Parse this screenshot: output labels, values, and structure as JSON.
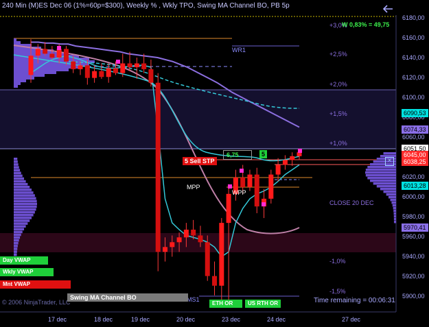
{
  "window": {
    "title": "240 Min (M)ES Dec 06  (1%=60p=$300), Weekly % , Wkly TPO, Swing MA Channel BO, PB 5p",
    "back_icon": "arrow-left-icon"
  },
  "colors": {
    "background": "#000000",
    "up_candle": "#ff1a1a",
    "down_candle": "#ff1a1a",
    "vwap": "#34c8d8",
    "swing_ma": "#8c6fe0",
    "tpo": "#6c4fd0",
    "sell": "#e01010",
    "price_highlight": "#00e0e0"
  },
  "labels": {
    "wr1": "WR1",
    "mpp": "MPP",
    "wpp": "WPP",
    "close_20": "CLOSE 20 DEC",
    "ms1": "MS1",
    "sell_stop": "5  Sell STP",
    "order_qty_value": "6,75",
    "order_qty_count": "5",
    "percent_change": "+3,0%",
    "w_change": "W 0,83% = 49,75",
    "time_remaining": "Time remaining = 00:06:31",
    "copyright": "© 2006 NinjaTrader, LLC"
  },
  "percent_levels": [
    "+2,5%",
    "+2,0%",
    "+1,5%",
    "+1,0%",
    "-1,0%",
    "-1,5%"
  ],
  "price_axis": {
    "ticks": [
      "6180,00",
      "6160,00",
      "6140,00",
      "6120,00",
      "6100,00",
      "6080,00",
      "6060,00",
      "6040,00",
      "6020,00",
      "6000,00",
      "5980,00",
      "5960,00",
      "5940,00",
      "5920,00",
      "5900,00"
    ],
    "highlights": [
      {
        "value": "6090,53",
        "bg": "#00e0e0",
        "fg": "#000000"
      },
      {
        "value": "6074,33",
        "bg": "#8a6fe8",
        "fg": "#000000"
      },
      {
        "value": "6051,50",
        "bg": "#ffffff",
        "fg": "#000000"
      },
      {
        "value": "6045,00",
        "bg": "#ff2a2a",
        "fg": "#ffffff"
      },
      {
        "value": "6038,25",
        "bg": "#ff2a2a",
        "fg": "#ffffff"
      },
      {
        "value": "6013,28",
        "bg": "#00e0e0",
        "fg": "#000000"
      },
      {
        "value": "5970,41",
        "bg": "#8a6fe8",
        "fg": "#000000"
      }
    ]
  },
  "x_axis": {
    "ticks": [
      "17 dec",
      "18 dec",
      "19 dec",
      "20 dec",
      "23 dec",
      "24 dec",
      "27 dec"
    ]
  },
  "buttons": {
    "day_vwap": "Day VWAP",
    "wkly_vwap": "Wkly VWAP",
    "mnt_vwap": "Mnt VWAP",
    "swing_channel": "Swing MA Channel BO",
    "eth_or": "ETH OR",
    "us_rth_or": "US RTH OR"
  },
  "chart_data": {
    "type": "candlestick",
    "title": "240 Min (M)ES Dec 06  (1%=60p=$300), Weekly % , Wkly TPO, Swing MA Channel BO, PB 5p",
    "ylim": [
      5885,
      6190
    ],
    "x_labels": [
      "17 dec",
      "18 dec",
      "19 dec",
      "20 dec",
      "23 dec",
      "24 dec",
      "27 dec"
    ],
    "candles": [
      {
        "o": 6128,
        "h": 6165,
        "l": 6120,
        "c": 6148
      },
      {
        "o": 6148,
        "h": 6160,
        "l": 6140,
        "c": 6155
      },
      {
        "o": 6155,
        "h": 6162,
        "l": 6148,
        "c": 6150
      },
      {
        "o": 6150,
        "h": 6158,
        "l": 6144,
        "c": 6146
      },
      {
        "o": 6146,
        "h": 6160,
        "l": 6140,
        "c": 6155
      },
      {
        "o": 6155,
        "h": 6158,
        "l": 6138,
        "c": 6142
      },
      {
        "o": 6142,
        "h": 6148,
        "l": 6130,
        "c": 6134
      },
      {
        "o": 6134,
        "h": 6142,
        "l": 6128,
        "c": 6138
      },
      {
        "o": 6138,
        "h": 6144,
        "l": 6118,
        "c": 6125
      },
      {
        "o": 6125,
        "h": 6138,
        "l": 6120,
        "c": 6132
      },
      {
        "o": 6132,
        "h": 6140,
        "l": 6124,
        "c": 6126
      },
      {
        "o": 6126,
        "h": 6140,
        "l": 6120,
        "c": 6135
      },
      {
        "o": 6135,
        "h": 6142,
        "l": 6128,
        "c": 6130
      },
      {
        "o": 6130,
        "h": 6150,
        "l": 6126,
        "c": 6140
      },
      {
        "o": 6140,
        "h": 6152,
        "l": 6132,
        "c": 6136
      },
      {
        "o": 6136,
        "h": 6146,
        "l": 6124,
        "c": 6140
      },
      {
        "o": 6140,
        "h": 6150,
        "l": 6130,
        "c": 6134
      },
      {
        "o": 6134,
        "h": 6144,
        "l": 6116,
        "c": 6120
      },
      {
        "o": 6120,
        "h": 6130,
        "l": 5925,
        "c": 5945
      },
      {
        "o": 5945,
        "h": 5960,
        "l": 5935,
        "c": 5950
      },
      {
        "o": 5950,
        "h": 5962,
        "l": 5940,
        "c": 5955
      },
      {
        "o": 5955,
        "h": 5965,
        "l": 5945,
        "c": 5960
      },
      {
        "o": 5960,
        "h": 5975,
        "l": 5950,
        "c": 5968
      },
      {
        "o": 5968,
        "h": 5978,
        "l": 5958,
        "c": 5962
      },
      {
        "o": 5962,
        "h": 5972,
        "l": 5950,
        "c": 5955
      },
      {
        "o": 5955,
        "h": 5962,
        "l": 5915,
        "c": 5920
      },
      {
        "o": 5920,
        "h": 5935,
        "l": 5900,
        "c": 5910
      },
      {
        "o": 5910,
        "h": 5980,
        "l": 5895,
        "c": 5975
      },
      {
        "o": 5975,
        "h": 6015,
        "l": 5892,
        "c": 6005
      },
      {
        "o": 6005,
        "h": 6030,
        "l": 5998,
        "c": 6022
      },
      {
        "o": 6022,
        "h": 6035,
        "l": 6005,
        "c": 6012
      },
      {
        "o": 6012,
        "h": 6030,
        "l": 6008,
        "c": 6025
      },
      {
        "o": 6025,
        "h": 6032,
        "l": 5985,
        "c": 5992
      },
      {
        "o": 5992,
        "h": 6010,
        "l": 5980,
        "c": 6000
      },
      {
        "o": 6000,
        "h": 6030,
        "l": 5995,
        "c": 6025
      },
      {
        "o": 6025,
        "h": 6042,
        "l": 6018,
        "c": 6035
      },
      {
        "o": 6035,
        "h": 6045,
        "l": 6030,
        "c": 6040
      },
      {
        "o": 6040,
        "h": 6048,
        "l": 6034,
        "c": 6044
      },
      {
        "o": 6044,
        "h": 6052,
        "l": 6040,
        "c": 6048
      }
    ],
    "series": [
      {
        "name": "Swing MA",
        "values": [
          6162,
          6162,
          6161,
          6161,
          6160,
          6160,
          6158,
          6157,
          6156,
          6155,
          6154,
          6153,
          6152,
          6150,
          6149,
          6148,
          6147,
          6146,
          6144,
          6142,
          6139,
          6136,
          6132,
          6128,
          6124,
          6120,
          6115,
          6110,
          6106,
          6102,
          6098,
          6094,
          6090,
          6086,
          6082,
          6078,
          6074
        ]
      },
      {
        "name": "VWAP",
        "values": [
          6130,
          6135,
          6140,
          6144,
          6146,
          6148,
          6146,
          6144,
          6141,
          6138,
          6136,
          6135,
          6135,
          6136,
          6137,
          6138,
          6138,
          6136,
          6070,
          6000,
          5975,
          5968,
          5962,
          5960,
          5958,
          5955,
          5950,
          5940,
          5945,
          5975,
          5990,
          6000,
          6005,
          6008,
          6012,
          6018,
          6025,
          6030,
          6035
        ]
      }
    ]
  }
}
